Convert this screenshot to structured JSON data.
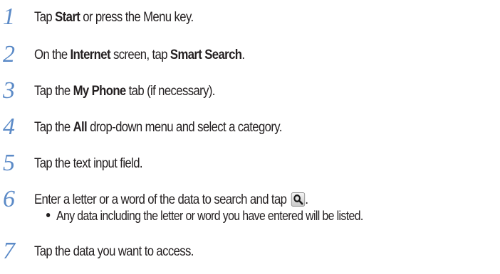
{
  "steps": [
    {
      "number": "1",
      "parts": [
        {
          "text": "Tap ",
          "bold": false
        },
        {
          "text": "Start",
          "bold": true
        },
        {
          "text": " or press the Menu key.",
          "bold": false
        }
      ]
    },
    {
      "number": "2",
      "parts": [
        {
          "text": "On the ",
          "bold": false
        },
        {
          "text": "Internet",
          "bold": true
        },
        {
          "text": " screen, tap ",
          "bold": false
        },
        {
          "text": "Smart Search",
          "bold": true
        },
        {
          "text": ".",
          "bold": false
        }
      ]
    },
    {
      "number": "3",
      "parts": [
        {
          "text": "Tap the ",
          "bold": false
        },
        {
          "text": "My Phone",
          "bold": true
        },
        {
          "text": " tab (if necessary).",
          "bold": false
        }
      ]
    },
    {
      "number": "4",
      "parts": [
        {
          "text": "Tap the ",
          "bold": false
        },
        {
          "text": "All",
          "bold": true
        },
        {
          "text": " drop-down menu and select a category.",
          "bold": false
        }
      ]
    },
    {
      "number": "5",
      "parts": [
        {
          "text": "Tap the text input field.",
          "bold": false
        }
      ]
    },
    {
      "number": "6",
      "parts": [
        {
          "text": "Enter a letter or a word of the data to search and tap ",
          "bold": false
        }
      ],
      "icon": "search-icon",
      "after_icon": ".",
      "sub_bullet": "Any data including the letter or word you have entered will be listed."
    },
    {
      "number": "7",
      "parts": [
        {
          "text": "Tap the data you want to access.",
          "bold": false
        }
      ]
    }
  ],
  "colors": {
    "step_number": "#5b8ac7",
    "text": "#231f20"
  }
}
